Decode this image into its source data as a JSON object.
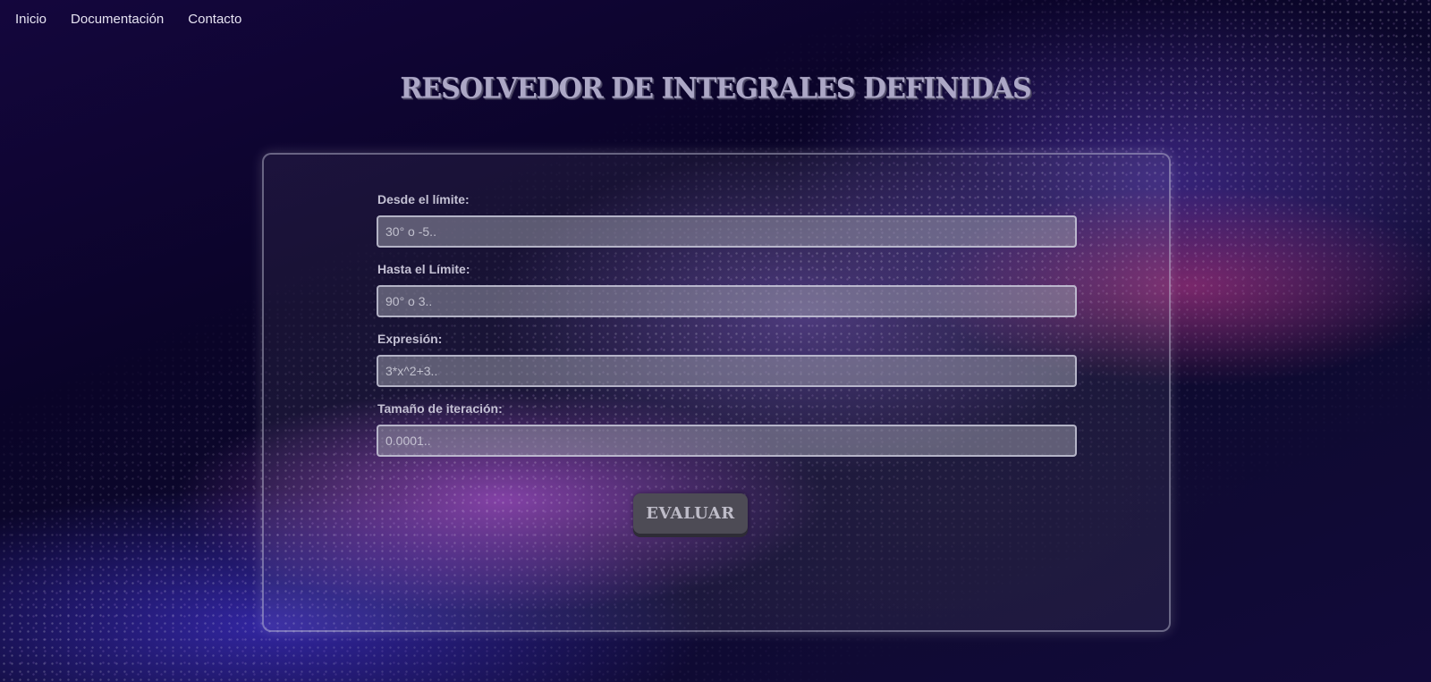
{
  "nav": {
    "items": [
      {
        "label": "Inicio"
      },
      {
        "label": "Documentación"
      },
      {
        "label": "Contacto"
      }
    ]
  },
  "header": {
    "title": "RESOLVEDOR DE INTEGRALES DEFINIDAS"
  },
  "form": {
    "fields": [
      {
        "label": "Desde el límite:",
        "placeholder": "30° o -5..",
        "value": ""
      },
      {
        "label": "Hasta el Límite:",
        "placeholder": "90° o 3..",
        "value": ""
      },
      {
        "label": "Expresión:",
        "placeholder": "3*x^2+3..",
        "value": ""
      },
      {
        "label": "Tamaño de iteración:",
        "placeholder": "0.0001..",
        "value": ""
      }
    ],
    "submit_label": "EVALUAR"
  },
  "colors": {
    "background": "#0b0630",
    "accent_purple": "#c45cff",
    "accent_pink": "#e23c8c",
    "title_text": "#aca7c6",
    "button_bg": "#4d4b55"
  }
}
